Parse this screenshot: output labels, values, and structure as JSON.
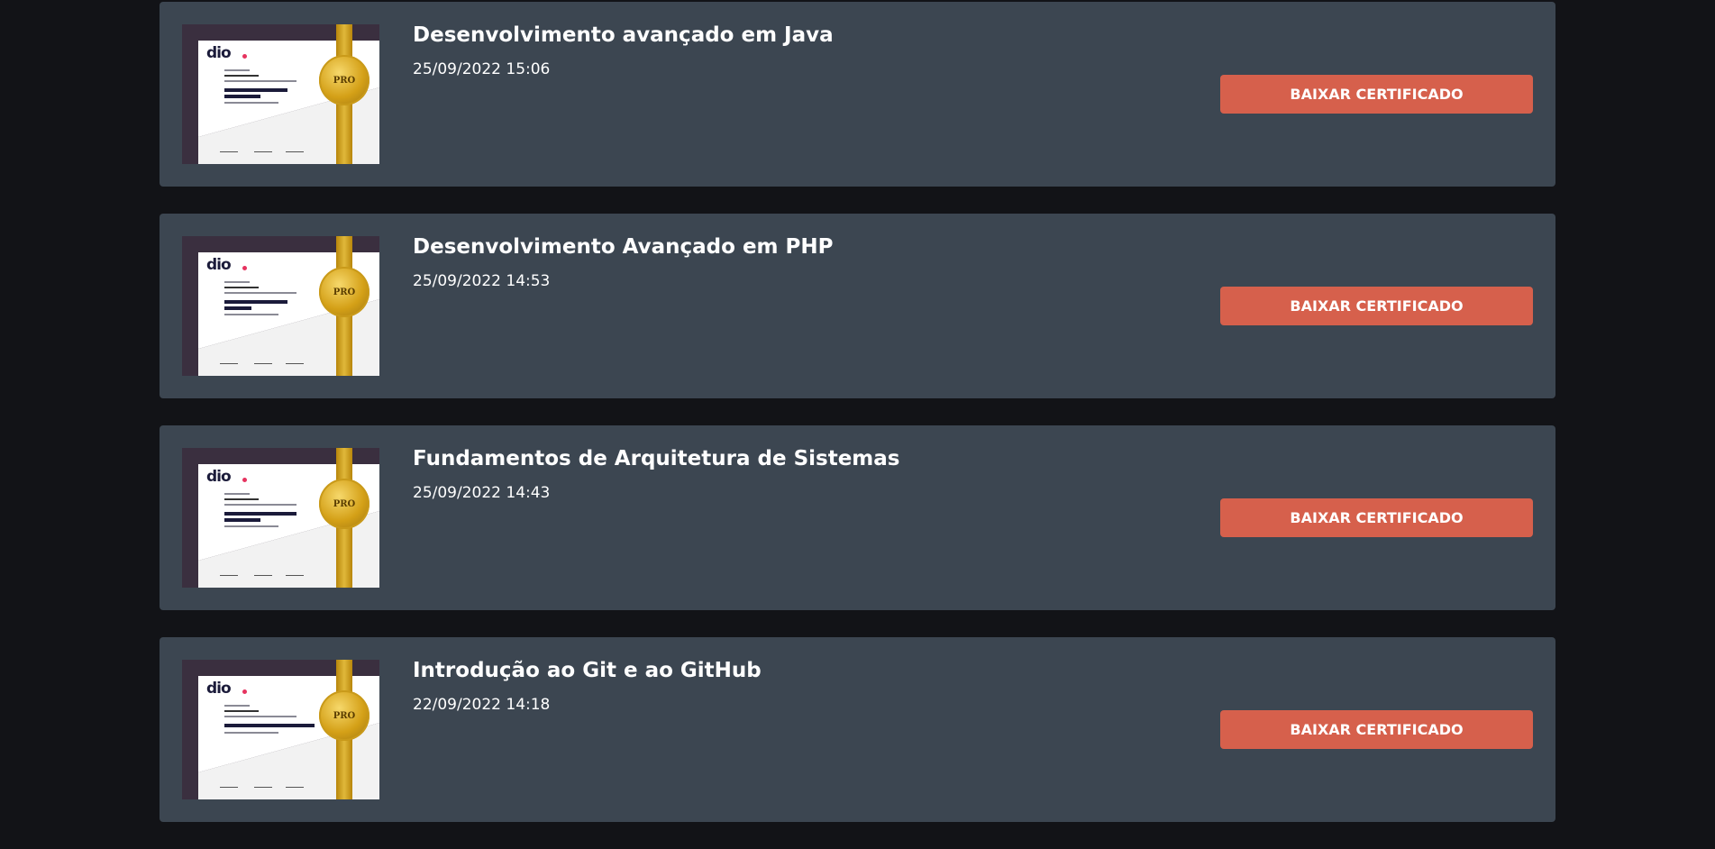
{
  "certificates": [
    {
      "title": "Desenvolvimento avançado em Java",
      "date": "25/09/2022 15:06",
      "button_label": "BAIXAR CERTIFICADO"
    },
    {
      "title": "Desenvolvimento Avançado em PHP",
      "date": "25/09/2022 14:53",
      "button_label": "BAIXAR CERTIFICADO"
    },
    {
      "title": "Fundamentos de Arquitetura de Sistemas",
      "date": "25/09/2022 14:43",
      "button_label": "BAIXAR CERTIFICADO"
    },
    {
      "title": "Introdução ao Git e ao GitHub",
      "date": "22/09/2022 14:18",
      "button_label": "BAIXAR CERTIFICADO"
    }
  ],
  "thumbnail": {
    "logo_text": "dio",
    "seal_text": "PRO"
  },
  "colors": {
    "background": "#121317",
    "card": "#3c4651",
    "button": "#d6604c",
    "text": "#ffffff"
  }
}
